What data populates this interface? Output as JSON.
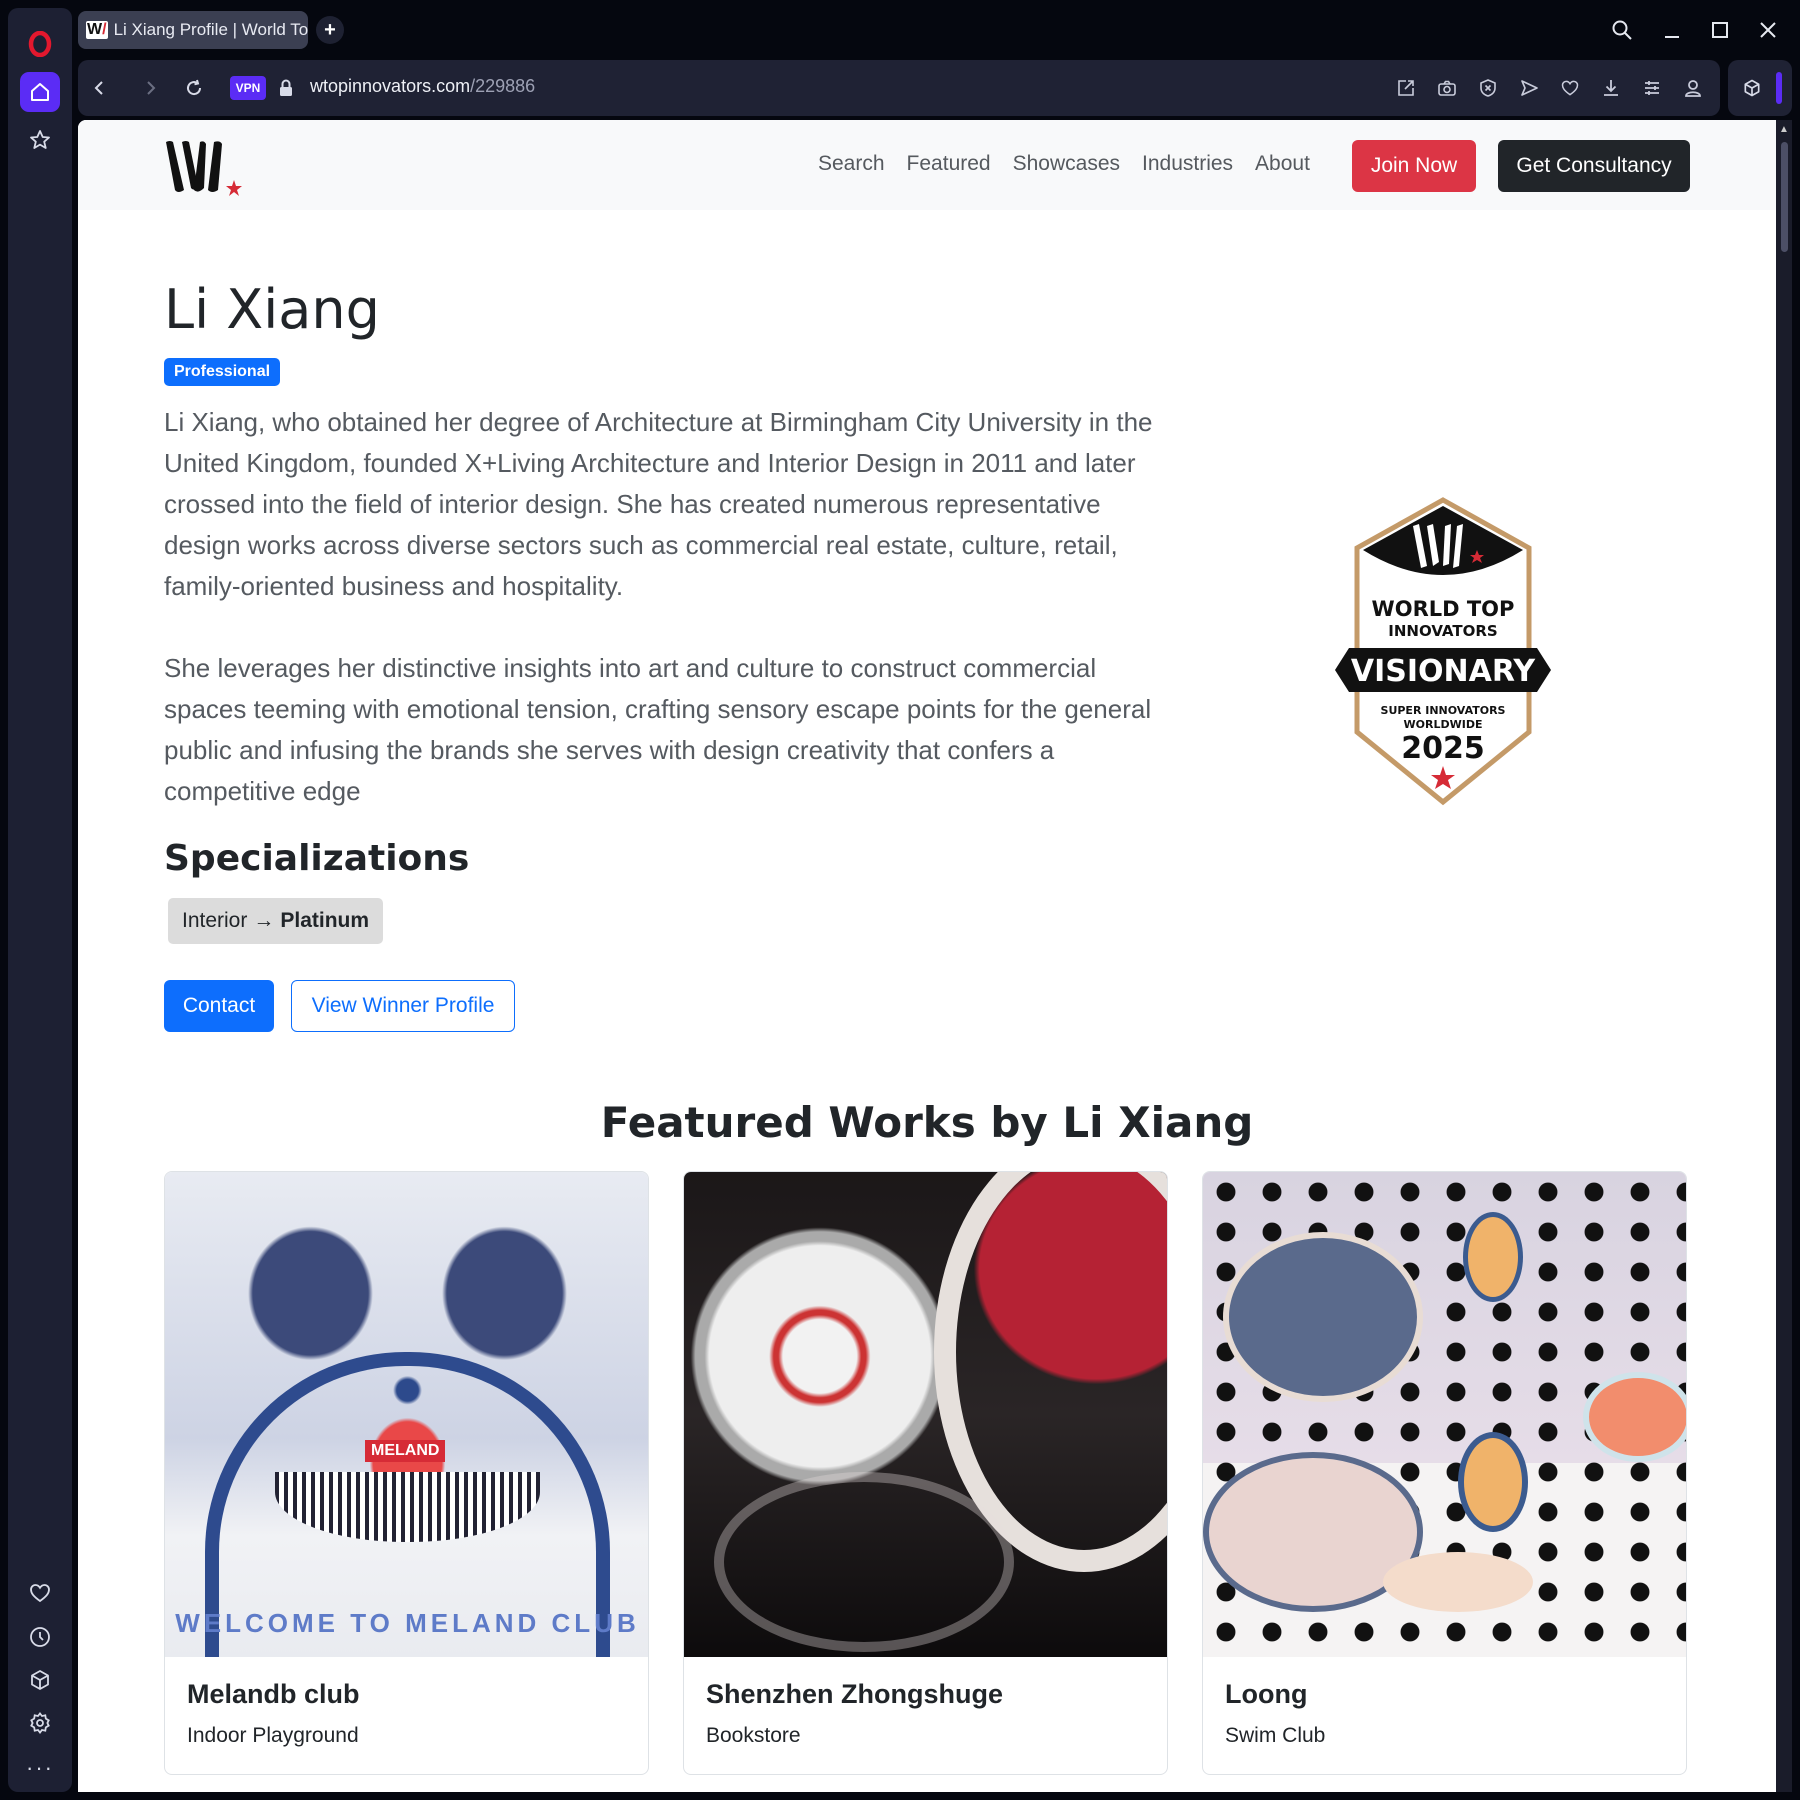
{
  "browser": {
    "tab_title": "Li Xiang Profile | World Top Innovators",
    "tab_favicon": "W",
    "new_tab_label": "+",
    "url_domain": "wtopinnovators.com",
    "url_path": "/229886",
    "vpn_label": "VPN",
    "sidebar_more": "···",
    "accent_color": "#5b2cf5"
  },
  "site": {
    "nav_links": [
      "Search",
      "Featured",
      "Showcases",
      "Industries",
      "About"
    ],
    "join_label": "Join Now",
    "consult_label": "Get Consultancy",
    "join_color": "#dc3545",
    "consult_color": "#212529"
  },
  "profile": {
    "name": "Li Xiang",
    "level_badge": "Professional",
    "bio": [
      "Li Xiang, who obtained her degree of Architecture at Birmingham City University in the United Kingdom, founded X+Living Architecture and Interior Design in 2011 and later crossed into the field of interior design. She has created numerous representative design works across diverse sectors such as commercial real estate, culture, retail, family-oriented business and hospitality.",
      "She leverages her distinctive insights into art and culture to construct commercial spaces teeming with emotional tension, crafting sensory escape points for the general public and infusing the brands she serves with design creativity that confers a competitive edge"
    ],
    "specializations_heading": "Specializations",
    "specializations": [
      {
        "field": "Interior",
        "arrow": "→",
        "level": "Platinum"
      }
    ],
    "contact_label": "Contact",
    "winner_profile_label": "View Winner Profile"
  },
  "award_badge": {
    "line1": "WORLD TOP",
    "line2": "INNOVATORS",
    "ribbon": "VISIONARY",
    "line3": "SUPER INNOVATORS",
    "line4": "WORLDWIDE",
    "year": "2025"
  },
  "featured": {
    "heading": "Featured Works by Li Xiang",
    "works": [
      {
        "title": "Melandb club",
        "category": "Indoor Playground",
        "image_sign": "MELAND",
        "image_floor_text": "WELCOME TO MELAND CLUB"
      },
      {
        "title": "Shenzhen Zhongshuge",
        "category": "Bookstore"
      },
      {
        "title": "Loong",
        "category": "Swim Club"
      }
    ]
  }
}
